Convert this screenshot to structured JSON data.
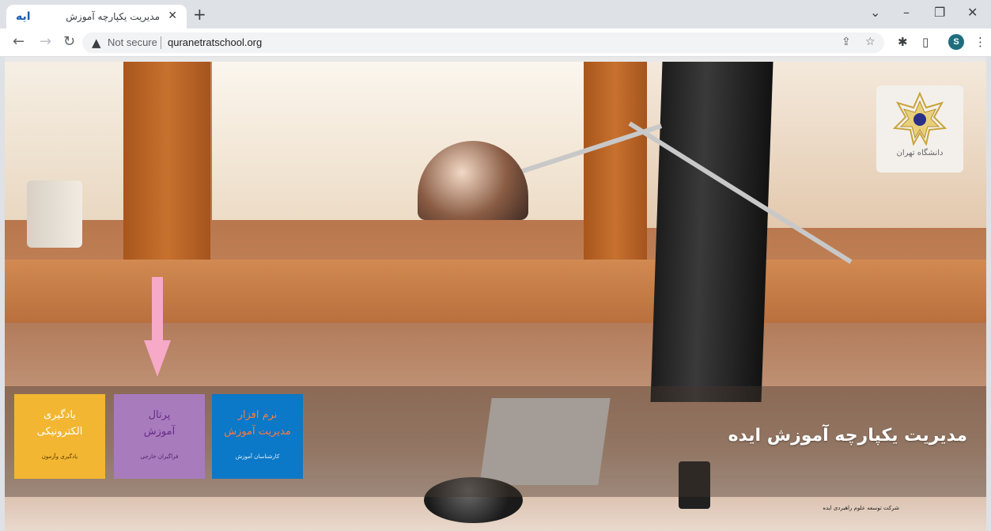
{
  "browser": {
    "tab": {
      "favicon_text": "ایه",
      "title": "مدیریت یکپارچه آموزش",
      "close_glyph": "✕"
    },
    "new_tab_glyph": "+",
    "window_controls": {
      "dropdown": "⌄",
      "minimize": "–",
      "restore": "❐",
      "close": "✕"
    },
    "nav": {
      "back": "←",
      "forward": "→",
      "reload": "↻"
    },
    "omnibox": {
      "warning_icon": "warning-triangle-icon",
      "security_label": "Not secure",
      "url": "quranetratschool.org"
    },
    "toolbar_icons": {
      "share": "⇪",
      "bookmark": "☆",
      "extensions": "✱",
      "sidepanel": "▯",
      "menu": "⋮"
    },
    "profile_initial": "S"
  },
  "page": {
    "headline": "مدیریت یکپارچه آموزش ایده",
    "credit": "شرکت توسعه علوم راهبردی ایده",
    "logo": {
      "caption": "دانشگاه تهران"
    },
    "tiles": [
      {
        "title": "یادگیری الکترونیکی",
        "subtitle": "یادگیری وآزمون",
        "color": "#f2b632",
        "text_color": "#ffffff"
      },
      {
        "title": "پرتال آموزش",
        "subtitle": "فراگیران خارجی",
        "color": "#a87bbd",
        "text_color": "#6a2d8a"
      },
      {
        "title": "نرم افزار مدیریت آموزش",
        "subtitle": "کارشناسان آموزش",
        "color": "#0b78c8",
        "text_color": "#ff7a3d"
      }
    ],
    "arrow_color": "#f7a9c8"
  }
}
